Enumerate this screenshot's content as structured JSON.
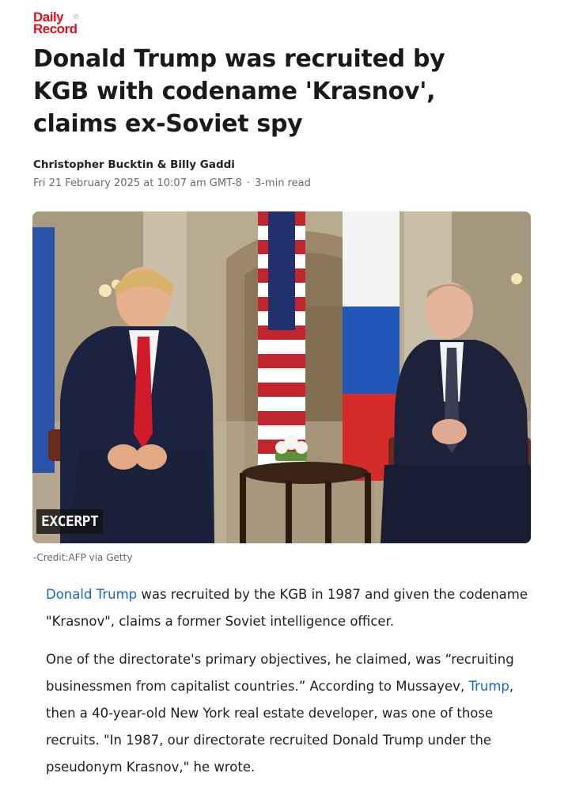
{
  "publication": {
    "logo_line1": "Daily",
    "logo_line2": "Record",
    "brand_color": "#e0101e"
  },
  "article": {
    "headline": "Donald Trump was recruited by KGB with codename 'Krasnov', claims ex-Soviet spy",
    "authors": "Christopher Bucktin & Billy Gaddi",
    "date": "Fri 21 February 2025 at 10:07 am GMT-8",
    "separator": "·",
    "read_time": "3-min read",
    "image": {
      "badge": "EXCERPT",
      "credit": "-Credit:AFP via Getty"
    },
    "paragraph1": {
      "link": "Donald Trump",
      "text": " was recruited by the KGB in 1987 and given the codename \"Krasnov\", claims a former Soviet intelligence officer."
    },
    "paragraph2": {
      "before": "One of the directorate's primary objectives, he claimed, was “recruiting businessmen from capitalist countries.” According to Mussayev, ",
      "link": "Trump",
      "after": ", then a 40-year-old New York real estate developer, was one of those recruits. \"In 1987, our directorate recruited Donald Trump under the pseudonym Krasnov,\" he wrote."
    },
    "link_color": "#1a63c9"
  }
}
